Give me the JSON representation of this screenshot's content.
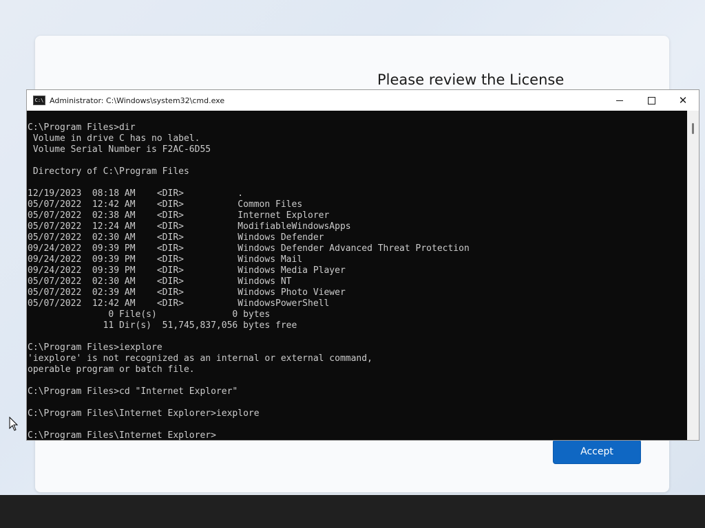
{
  "setup": {
    "title": "Please review the License",
    "accept_label": "Accept"
  },
  "cmd": {
    "window_title": "Administrator: C:\\Windows\\system32\\cmd.exe",
    "icon_text": "C:\\",
    "controls": {
      "minimize": "minimize-icon",
      "maximize": "maximize-icon",
      "close": "✕"
    },
    "lines": [
      "C:\\Program Files>dir",
      " Volume in drive C has no label.",
      " Volume Serial Number is F2AC-6D55",
      "",
      " Directory of C:\\Program Files",
      "",
      "12/19/2023  08:18 AM    <DIR>          .",
      "05/07/2022  12:42 AM    <DIR>          Common Files",
      "05/07/2022  02:38 AM    <DIR>          Internet Explorer",
      "05/07/2022  12:24 AM    <DIR>          ModifiableWindowsApps",
      "05/07/2022  02:30 AM    <DIR>          Windows Defender",
      "09/24/2022  09:39 PM    <DIR>          Windows Defender Advanced Threat Protection",
      "09/24/2022  09:39 PM    <DIR>          Windows Mail",
      "09/24/2022  09:39 PM    <DIR>          Windows Media Player",
      "05/07/2022  02:30 AM    <DIR>          Windows NT",
      "05/07/2022  02:39 AM    <DIR>          Windows Photo Viewer",
      "05/07/2022  12:42 AM    <DIR>          WindowsPowerShell",
      "               0 File(s)              0 bytes",
      "              11 Dir(s)  51,745,837,056 bytes free",
      "",
      "C:\\Program Files>iexplore",
      "'iexplore' is not recognized as an internal or external command,",
      "operable program or batch file.",
      "",
      "C:\\Program Files>cd \"Internet Explorer\"",
      "",
      "C:\\Program Files\\Internet Explorer>iexplore",
      "",
      "C:\\Program Files\\Internet Explorer>"
    ]
  },
  "colors": {
    "console_bg": "#0c0c0c",
    "console_text": "#cccccc",
    "accent": "#0f67c3",
    "taskbar": "#202020"
  }
}
